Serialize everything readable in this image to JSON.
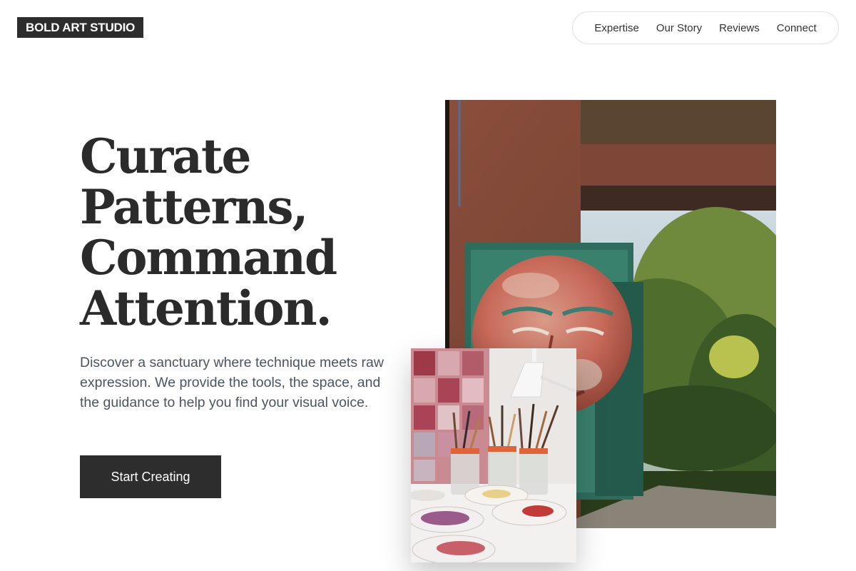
{
  "brand": {
    "logo_text": "BOLD ART STUDIO"
  },
  "nav": {
    "items": [
      {
        "label": "Expertise"
      },
      {
        "label": "Our Story"
      },
      {
        "label": "Reviews"
      },
      {
        "label": "Connect"
      }
    ]
  },
  "hero": {
    "headline_lines": [
      "Curate",
      "Patterns,",
      "Command",
      "Attention."
    ],
    "intro": "Discover a sanctuary where technique meets raw expression. We provide the tools, the space, and the guidance to help you find your visual voice.",
    "cta_label": "Start Creating"
  },
  "colors": {
    "ink": "#2d2d2d",
    "body_text": "#4a5563",
    "background": "#ffffff"
  }
}
